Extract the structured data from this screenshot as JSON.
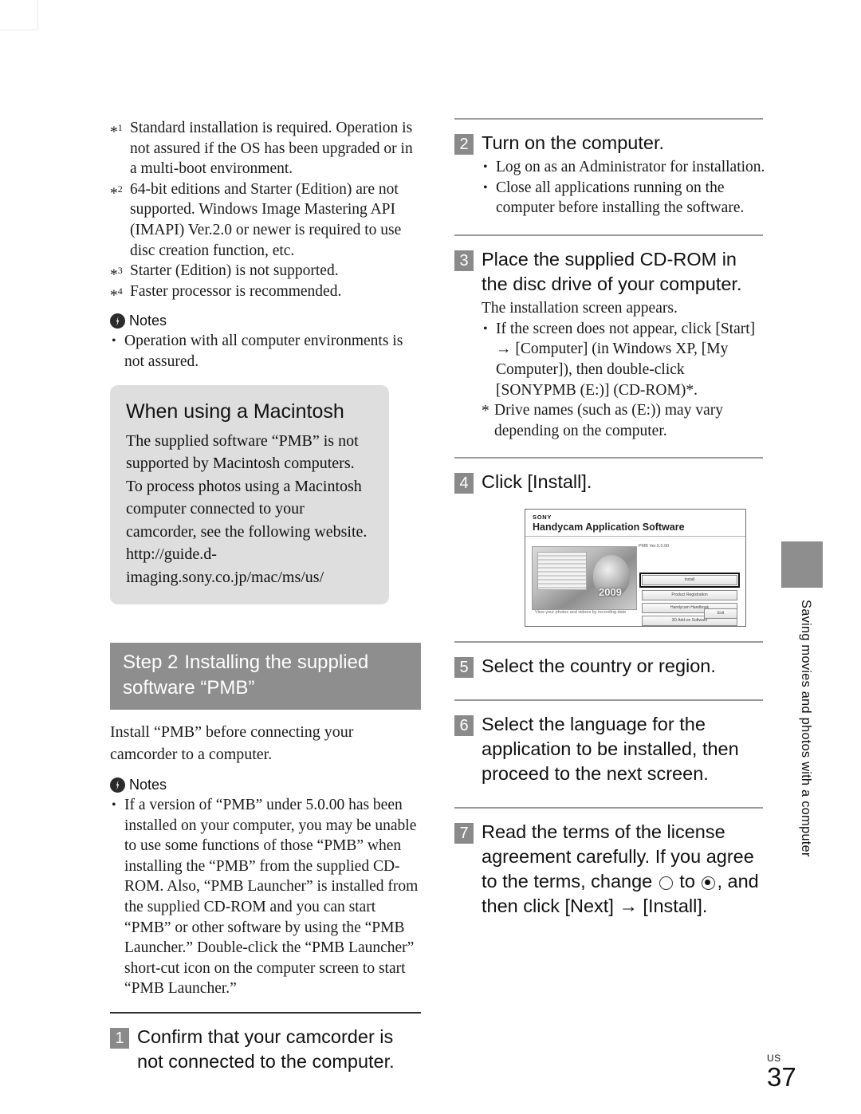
{
  "page": {
    "folio_region": "US",
    "folio_number": "37"
  },
  "side_tab": {
    "label": "Saving movies and photos with a computer"
  },
  "left_column": {
    "footnotes": [
      {
        "mark": "*1",
        "text": "Standard installation is required. Operation is not assured if the OS has been upgraded or in a multi-boot environment."
      },
      {
        "mark": "*2",
        "text": "64-bit editions and Starter (Edition) are not supported. Windows Image Mastering API (IMAPI) Ver.2.0 or newer is required to use disc creation function, etc."
      },
      {
        "mark": "*3",
        "text": "Starter (Edition) is not supported."
      },
      {
        "mark": "*4",
        "text": "Faster processor is recommended."
      }
    ],
    "notes_1": {
      "icon": "notes-lightning-icon",
      "label": "Notes",
      "items": [
        "Operation with all computer environments is not assured."
      ]
    },
    "macintosh_box": {
      "title": "When using a Macintosh",
      "paragraphs": [
        "The supplied software “PMB” is not supported by Macintosh computers.",
        "To process photos using a Macintosh computer connected to your camcorder, see the following website.",
        "http://guide.d-imaging.sony.co.jp/mac/ms/us/"
      ]
    },
    "step_header": {
      "lead": "Step 2",
      "title": "Installing the supplied software “PMB”"
    },
    "intro": "Install “PMB” before connecting your camcorder to a computer.",
    "notes_2": {
      "icon": "notes-lightning-icon",
      "label": "Notes",
      "items": [
        "If a version of “PMB” under 5.0.00 has been installed on your computer, you may be unable to use some functions of those “PMB” when installing the “PMB” from the supplied CD-ROM. Also, “PMB Launcher” is installed from the supplied CD-ROM and you can start “PMB” or other software by using the “PMB Launcher.” Double-click the “PMB Launcher” short-cut icon on the computer screen to start “PMB Launcher.”"
      ]
    },
    "step_1": {
      "number": "1",
      "text": "Confirm that your camcorder is not connected to the computer."
    }
  },
  "right_column": {
    "step_2": {
      "number": "2",
      "text": "Turn on the computer.",
      "bullets": [
        "Log on as an Administrator for installation.",
        "Close all applications running on the computer before installing the software."
      ]
    },
    "step_3": {
      "number": "3",
      "text": "Place the supplied CD-ROM in the disc drive of your computer.",
      "lead": "The installation screen appears.",
      "bullets": [
        "If the screen does not appear, click [Start] → [Computer] (in Windows XP, [My Computer]), then double-click [SONYPMB (E:)] (CD-ROM)*."
      ],
      "starnote": "Drive names (such as (E:)) may vary depending on the computer."
    },
    "step_4": {
      "number": "4",
      "text": "Click [Install]."
    },
    "installer_screenshot": {
      "brand": "SONY",
      "title": "Handycam Application Software",
      "version": "PMB Ver.5.0.00",
      "year_badge": "2009",
      "caption": "View your photos and videos by recording date",
      "buttons": [
        "Install",
        "Product Registration",
        "Handycam Handbook",
        "3D Add-on Software"
      ],
      "exit_button": "Exit"
    },
    "step_5": {
      "number": "5",
      "text": "Select the country or region."
    },
    "step_6": {
      "number": "6",
      "text": "Select the language for the application to be installed, then proceed to the next screen."
    },
    "step_7": {
      "number": "7",
      "text_part_1": "Read the terms of the license agreement carefully. If you agree to the terms, change",
      "text_part_2": "to",
      "text_part_3": ", and then click [Next] → [Install]."
    }
  },
  "colors": {
    "step_bar_gray": "#8e8e8e",
    "step_number_gray": "#8a8a8a",
    "mac_box_gray": "#dedede",
    "rule_dark": "#2f2f2f",
    "rule_gray": "#9a9a9a"
  }
}
